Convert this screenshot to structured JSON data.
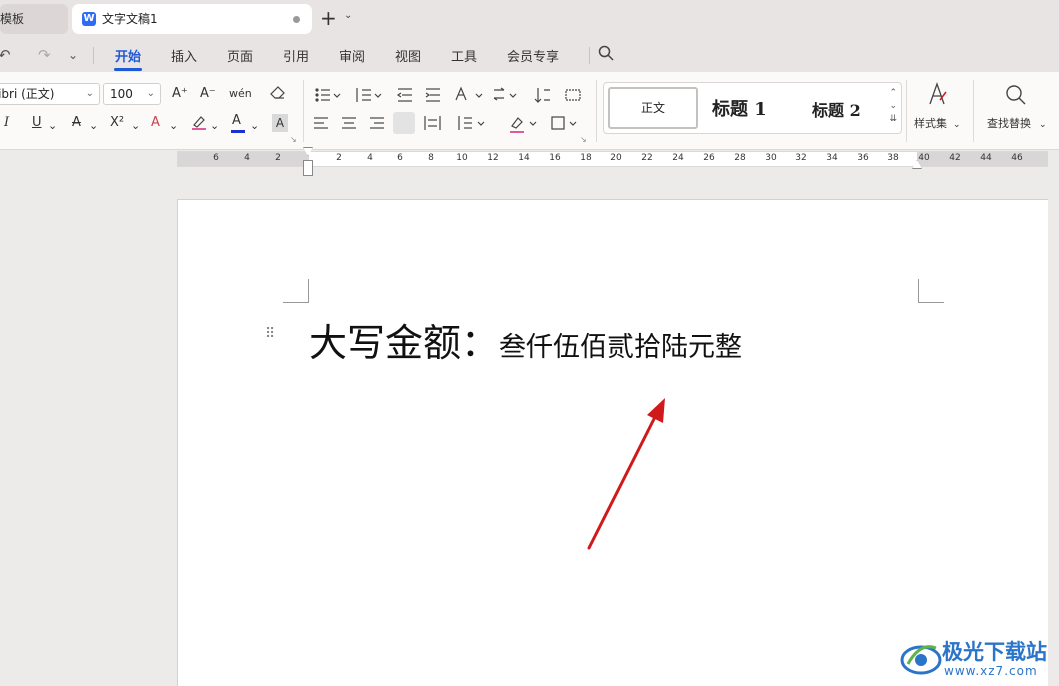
{
  "tabs": {
    "prev_tab": "稿壳模板",
    "active_tab": "文字文稿1",
    "active_icon": "W",
    "add": "+",
    "add_menu": "⌄"
  },
  "quick_access": {
    "undo": "↶",
    "redo": "↷",
    "more": "⌄"
  },
  "menu": {
    "items": [
      "开始",
      "插入",
      "页面",
      "引用",
      "审阅",
      "视图",
      "工具",
      "会员专享"
    ],
    "active": "开始"
  },
  "ribbon": {
    "font_name": "Calibri (正文)",
    "font_size": "100",
    "grow_font": "A⁺",
    "shrink_font": "A⁻",
    "phonetic": "wén",
    "clear_format": "⌫",
    "italic": "I",
    "underline": "U",
    "strikethrough": "A",
    "superscript": "X²",
    "text_effect": "A",
    "highlight": "∠",
    "font_color": "A",
    "char_shading": "A",
    "styles": {
      "normal": "正文",
      "heading1": "标题 1",
      "heading2": "标题 2"
    },
    "style_set": "样式集",
    "find_replace": "查找替换"
  },
  "ruler": {
    "left_numbers": [
      "6",
      "4",
      "2"
    ],
    "numbers": [
      "2",
      "4",
      "6",
      "8",
      "10",
      "12",
      "14",
      "16",
      "18",
      "20",
      "22",
      "24",
      "26",
      "28",
      "30",
      "32",
      "34",
      "36",
      "38",
      "40",
      "42",
      "44",
      "46"
    ]
  },
  "document": {
    "label": "大写金额：",
    "value": "叁仟伍佰贰拾陆元整"
  },
  "watermark": {
    "title": "极光下载站",
    "url": "www.xz7.com"
  },
  "colors": {
    "accent": "#1f5ad6",
    "font_color_bar": "#1a2fd6",
    "arrow": "#d0191b",
    "watermark": "#2a74c9"
  }
}
